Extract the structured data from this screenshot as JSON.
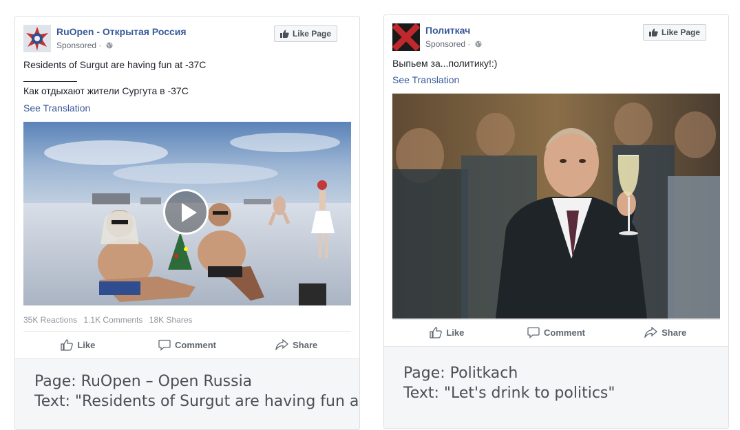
{
  "left_post": {
    "page_name": "RuOpen - Открытая Россия",
    "sponsored": "Sponsored ·",
    "like_page_label": "Like Page",
    "text_line1": "Residents of Surgut are having fun at -37C",
    "text_line2": "Как отдыхают жители Сургута в -37C",
    "see_translation": "See Translation",
    "stats": {
      "reactions": "35K Reactions",
      "comments": "1.1K Comments",
      "shares": "18K Shares"
    },
    "actions": {
      "like": "Like",
      "comment": "Comment",
      "share": "Share"
    },
    "caption_line1": "Page: RuOpen – Open Russia",
    "caption_line2": "Text: \"Residents of Surgut are having fun at"
  },
  "right_post": {
    "page_name": "Политкач",
    "sponsored": "Sponsored ·",
    "like_page_label": "Like Page",
    "text_line1": "Выпьем за...политику!:)",
    "see_translation": "See Translation",
    "actions": {
      "like": "Like",
      "comment": "Comment",
      "share": "Share"
    },
    "caption_line1": "Page: Politkach",
    "caption_line2": "Text: \"Let's drink to politics\""
  },
  "colors": {
    "link_blue": "#365899",
    "gray_text": "#606770",
    "border": "#dddfe2",
    "caption_bg": "#f5f6f7"
  },
  "icons": [
    "globe-icon",
    "thumbs-up-icon",
    "comment-icon",
    "share-icon",
    "play-icon"
  ]
}
